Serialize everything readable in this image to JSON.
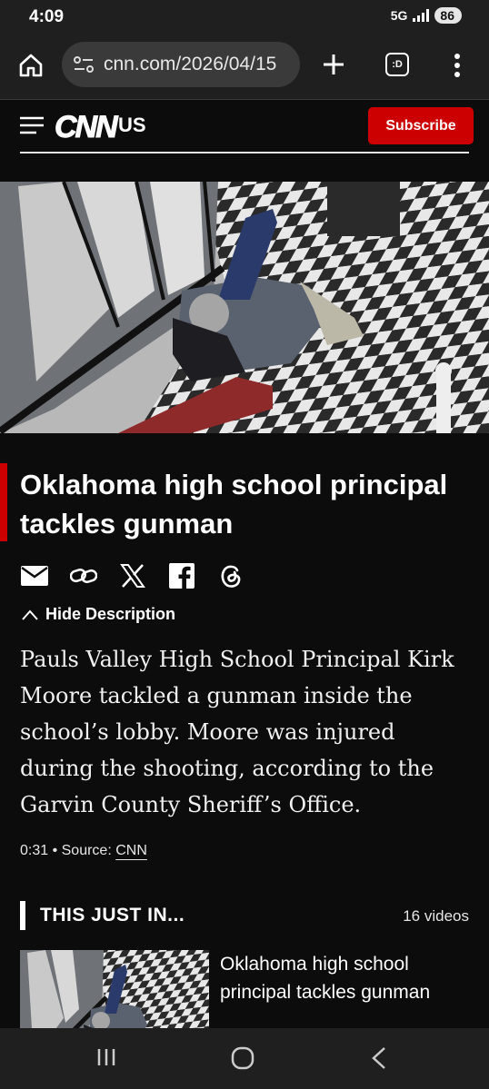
{
  "status": {
    "time": "4:09",
    "network": "5G",
    "battery": "86"
  },
  "browser": {
    "url": "cnn.com/2026/04/15",
    "tabs_label": ":D"
  },
  "cnn": {
    "edition": "US",
    "subscribe": "Subscribe",
    "logo": "CNN"
  },
  "article": {
    "headline": "Oklahoma high school principal tackles gunman",
    "hide_description": "Hide Description",
    "description": "Pauls Valley High School Principal Kirk Moore tackled a gunman inside the school’s lobby. Moore was injured during the shooting, according to the Garvin County Sheriff’s Office.",
    "duration": "0:31",
    "source_label": " • Source: ",
    "source": "CNN"
  },
  "share_icons": [
    "email-icon",
    "link-icon",
    "x-icon",
    "facebook-icon",
    "threads-icon"
  ],
  "playlist": {
    "title": "THIS JUST IN...",
    "count": "16 videos",
    "items": [
      {
        "title": "Oklahoma high school principal tackles gunman"
      }
    ]
  },
  "colors": {
    "accent": "#cc0000",
    "background": "#0c0c0c",
    "chrome": "#1f1f1f"
  }
}
